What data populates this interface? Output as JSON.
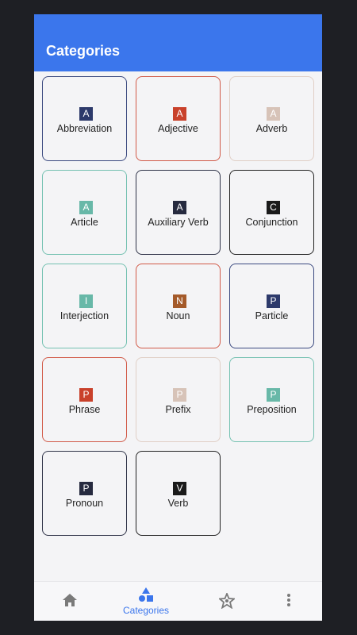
{
  "app": {
    "title": "Categories"
  },
  "colors": {
    "accent": "#3b76ec",
    "nav_inactive": "#7a7a7a"
  },
  "categories": [
    {
      "badge": "A",
      "label": "Abbreviation",
      "color": "#2d3a6b",
      "border": "#3b4a80"
    },
    {
      "badge": "A",
      "label": "Adjective",
      "color": "#c9412b",
      "border": "#d15a48"
    },
    {
      "badge": "A",
      "label": "Adverb",
      "color": "#d7c3b8",
      "border": "#e0cfc6"
    },
    {
      "badge": "A",
      "label": "Article",
      "color": "#68b8a8",
      "border": "#74c1b1"
    },
    {
      "badge": "A",
      "label": "Auxiliary Verb",
      "color": "#262a3f",
      "border": "#2f3348"
    },
    {
      "badge": "C",
      "label": "Conjunction",
      "color": "#1a1a1a",
      "border": "#222222"
    },
    {
      "badge": "I",
      "label": "Interjection",
      "color": "#68b8a8",
      "border": "#74c1b1"
    },
    {
      "badge": "N",
      "label": "Noun",
      "color": "#a45a2a",
      "border": "#d15a48"
    },
    {
      "badge": "P",
      "label": "Particle",
      "color": "#2d3a6b",
      "border": "#3b4a80"
    },
    {
      "badge": "P",
      "label": "Phrase",
      "color": "#c9412b",
      "border": "#d15a48"
    },
    {
      "badge": "P",
      "label": "Prefix",
      "color": "#d7c3b8",
      "border": "#e0cfc6"
    },
    {
      "badge": "P",
      "label": "Preposition",
      "color": "#68b8a8",
      "border": "#74c1b1"
    },
    {
      "badge": "P",
      "label": "Pronoun",
      "color": "#262a3f",
      "border": "#2f3348"
    },
    {
      "badge": "V",
      "label": "Verb",
      "color": "#1a1a1a",
      "border": "#222222"
    }
  ],
  "nav": [
    {
      "icon": "home-icon",
      "label": ""
    },
    {
      "icon": "shapes-icon",
      "label": "Categories",
      "active": true
    },
    {
      "icon": "sparkle-star-icon",
      "label": ""
    },
    {
      "icon": "more-vert-icon",
      "label": ""
    }
  ]
}
